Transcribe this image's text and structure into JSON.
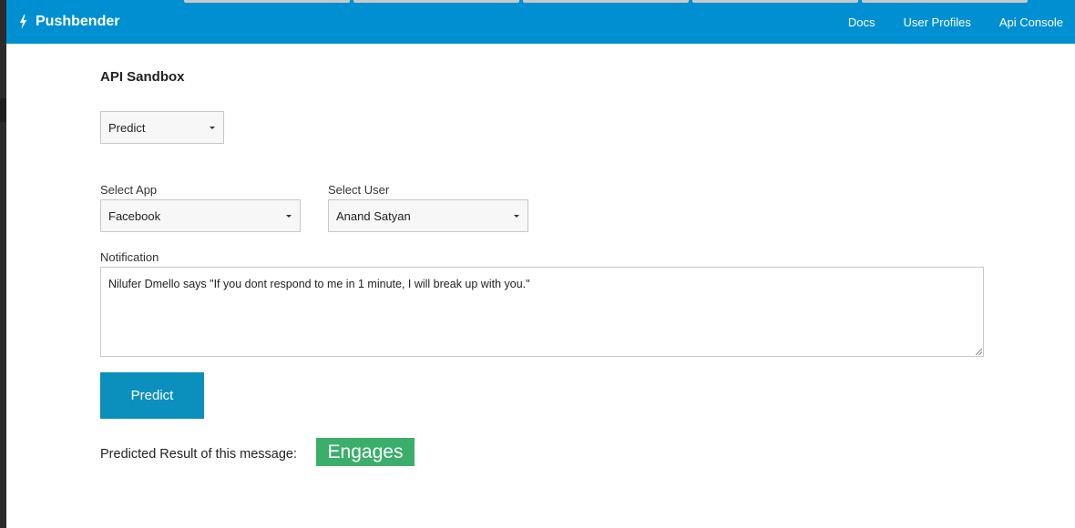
{
  "navbar": {
    "brand_name": "Pushbender",
    "brand_icon": "lightning-bolt-icon",
    "links": [
      "Docs",
      "User Profiles",
      "Api Console"
    ]
  },
  "page": {
    "title": "API Sandbox"
  },
  "endpoint_select": {
    "value": "Predict"
  },
  "app_select": {
    "label": "Select App",
    "value": "Facebook"
  },
  "user_select": {
    "label": "Select User",
    "value": "Anand Satyan"
  },
  "notification": {
    "label": "Notification",
    "value": "Nilufer Dmello says \"If you dont respond to me in 1 minute, I will break up with you.\""
  },
  "predict_button": {
    "label": "Predict"
  },
  "result": {
    "label": "Predicted Result of this message:",
    "value": "Engages"
  },
  "colors": {
    "navbar": "#0090d1",
    "button": "#0b8fbd",
    "result_badge": "#3cae6c"
  }
}
